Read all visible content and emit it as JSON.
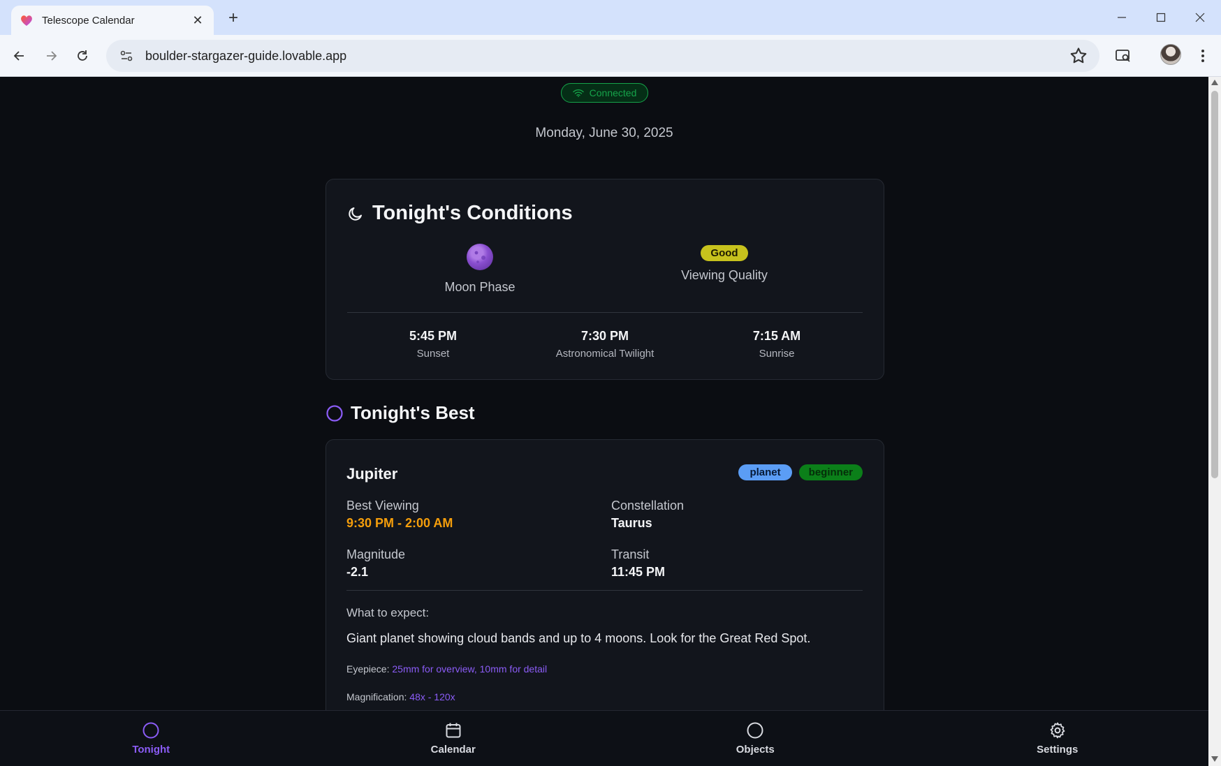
{
  "browser": {
    "tab_title": "Telescope Calendar",
    "url": "boulder-stargazer-guide.lovable.app"
  },
  "status": {
    "connection": "Connected",
    "color": "#16a34a"
  },
  "date": "Monday, June 30, 2025",
  "conditions": {
    "title": "Tonight's Conditions",
    "moon_label": "Moon Phase",
    "viewing_badge": "Good",
    "viewing_label": "Viewing Quality",
    "times": [
      {
        "value": "5:45 PM",
        "label": "Sunset"
      },
      {
        "value": "7:30 PM",
        "label": "Astronomical Twilight"
      },
      {
        "value": "7:15 AM",
        "label": "Sunrise"
      }
    ]
  },
  "best": {
    "title": "Tonight's Best",
    "object": {
      "name": "Jupiter",
      "tags": [
        "planet",
        "beginner"
      ],
      "best_viewing_label": "Best Viewing",
      "best_viewing": "9:30 PM - 2:00 AM",
      "constellation_label": "Constellation",
      "constellation": "Taurus",
      "magnitude_label": "Magnitude",
      "magnitude": "-2.1",
      "transit_label": "Transit",
      "transit": "11:45 PM",
      "expect_label": "What to expect:",
      "expect": "Giant planet showing cloud bands and up to 4 moons. Look for the Great Red Spot.",
      "eyepiece_label": "Eyepiece:",
      "eyepiece": "25mm for overview, 10mm for detail",
      "magnification_label": "Magnification:",
      "magnification": "48x - 120x"
    }
  },
  "nav": {
    "items": [
      {
        "label": "Tonight",
        "icon": "circle-icon",
        "active": true
      },
      {
        "label": "Calendar",
        "icon": "calendar-icon",
        "active": false
      },
      {
        "label": "Objects",
        "icon": "circle-icon",
        "active": false
      },
      {
        "label": "Settings",
        "icon": "gear-icon",
        "active": false
      }
    ]
  },
  "colors": {
    "accent": "#8b5cf6",
    "orange": "#f59e0b",
    "good": "#c7c21d",
    "planet": "#5b9df5",
    "beginner": "#0b7f19"
  }
}
